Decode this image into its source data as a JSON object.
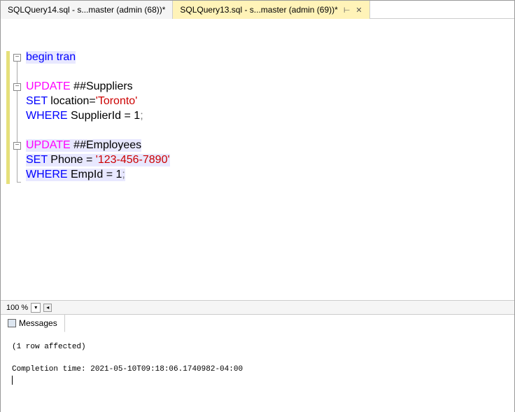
{
  "tabs": [
    {
      "label": "SQLQuery14.sql - s...master (admin (68))*"
    },
    {
      "label": "SQLQuery13.sql - s...master (admin (69))*"
    }
  ],
  "code": {
    "l1_begin": "begin",
    "l1_tran": " tran",
    "l2_update": "UPDATE",
    "l2_tbl": " ##Suppliers",
    "l3_set": "SET",
    "l3_col": " location=",
    "l3_val": "'Toronto'",
    "l4_where": "WHERE",
    "l4_cond": " SupplierId = 1",
    "l4_semi": ";",
    "l5_update": "UPDATE",
    "l5_tbl": " ##Employees",
    "l6_set": "  SET",
    "l6_col": " Phone = ",
    "l6_val": "'123-456-7890'",
    "l7_where": "  WHERE",
    "l7_cond": " EmpId = 1",
    "l7_semi": ";"
  },
  "zoom": "100 %",
  "resultsTab": "Messages",
  "messages": {
    "affected": "(1 row affected)",
    "completion": "Completion time: 2021-05-10T09:18:06.1740982-04:00"
  }
}
